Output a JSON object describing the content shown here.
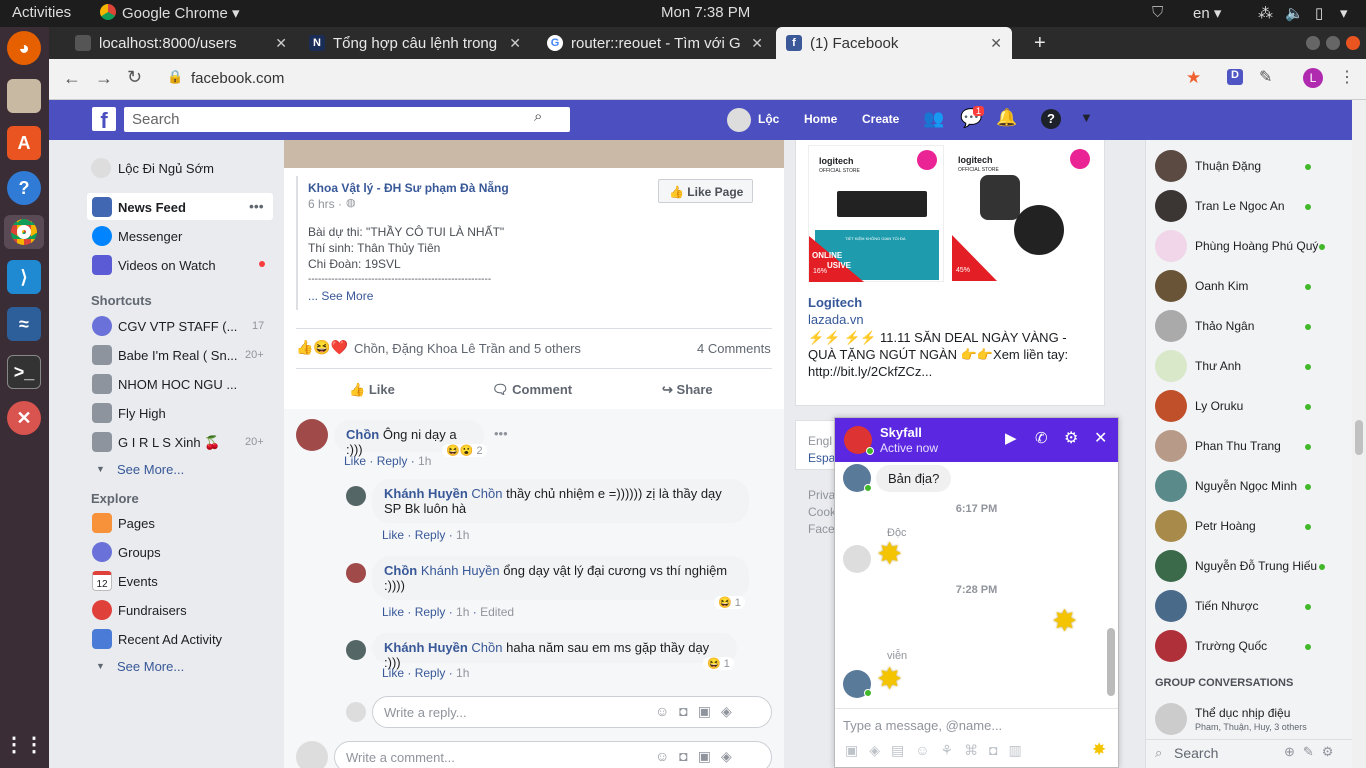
{
  "os": {
    "activities": "Activities",
    "app_menu": "Google Chrome",
    "clock": "Mon  7:38 PM",
    "lang": "en"
  },
  "browser": {
    "tabs": [
      {
        "title": "localhost:8000/users",
        "favicon": "page-icon"
      },
      {
        "title": "Tổng hợp câu lệnh trong",
        "favicon": "N"
      },
      {
        "title": "router::reouet - Tìm với G",
        "favicon": "G"
      },
      {
        "title": "(1) Facebook",
        "favicon": "f"
      }
    ],
    "url": "facebook.com",
    "ext_d": "D",
    "profile": "L"
  },
  "fb": {
    "search_placeholder": "Search",
    "user": "Lộc",
    "nav": {
      "home": "Home",
      "create": "Create"
    },
    "messages_badge": "1"
  },
  "left": {
    "profile": "Lộc Đi Ngủ Sớm",
    "items": [
      {
        "label": "News Feed"
      },
      {
        "label": "Messenger"
      },
      {
        "label": "Videos on Watch"
      }
    ],
    "shortcuts_title": "Shortcuts",
    "shortcuts": [
      {
        "label": "CGV VTP STAFF (...",
        "count": "17"
      },
      {
        "label": "Babe I'm Real ( Sn...",
        "count": "20+"
      },
      {
        "label": "NHOM HOC NGU ...",
        "count": ""
      },
      {
        "label": "Fly High",
        "count": ""
      },
      {
        "label": "G I R L S Xinh 🍒",
        "count": "20+"
      }
    ],
    "see_more": "See More...",
    "explore_title": "Explore",
    "explore": [
      {
        "label": "Pages"
      },
      {
        "label": "Groups"
      },
      {
        "label": "Events"
      },
      {
        "label": "Fundraisers"
      },
      {
        "label": "Recent Ad Activity"
      }
    ],
    "events_day": "12"
  },
  "post": {
    "page_name": "Khoa Vật lý - ĐH Sư phạm Đà Nẵng",
    "time": "6 hrs ·",
    "like_page": "Like Page",
    "lines": [
      "Bài dự thi: \"THẦY CÔ TUI LÀ NHẤT\"",
      "Thí sinh: Thân Thủy Tiên",
      "Chi Đoàn: 19SVL",
      "-------------------------------------------------------"
    ],
    "see_more": "... See More",
    "reactions_text": "Chồn, Đặng Khoa Lê Trần and 5 others",
    "comments_count": "4 Comments",
    "actions": {
      "like": "Like",
      "comment": "Comment",
      "share": "Share"
    }
  },
  "comments": [
    {
      "name": "Chồn",
      "text": "Ông ni dạy a :)))",
      "like": "Like",
      "reply": "Reply",
      "time": "1h",
      "react": "2"
    },
    {
      "name": "Khánh Huyền",
      "tag": "Chồn",
      "text": " thầy chủ nhiệm e =)))))) zị là thầy dạy SP Bk luôn hà",
      "text2": "SP Bk luôn hà",
      "like": "Like",
      "reply": "Reply",
      "time": "1h"
    },
    {
      "name": "Chồn",
      "tag": "Khánh Huyền",
      "text": " ổng dạy vật lý đại cương vs thí nghiệm",
      "text2": ":))))",
      "like": "Like",
      "reply": "Reply",
      "time": "1h",
      "edited": "Edited",
      "react": "1"
    },
    {
      "name": "Khánh Huyền",
      "tag": "Chồn",
      "text": " haha năm sau em ms gặp thầy dạy :)))",
      "like": "Like",
      "reply": "Reply",
      "time": "1h",
      "react": "1"
    }
  ],
  "reply_placeholder": "Write a reply...",
  "comment_placeholder": "Write a comment...",
  "ad": {
    "brand": "Logitech",
    "domain": "lazada.vn",
    "text": "⚡⚡ ⚡⚡ 11.11 SĂN DEAL NGÀY VÀNG - QUÀ TẶNG NGÚT NGÀN 👉👉Xem liền tay: http://bit.ly/2CkfZCz...",
    "card1_title": "logitech",
    "card1_sub": "OFFICIAL STORE",
    "card1_tag": "TIẾT KIỆM KHÔNG GIAN TỐI ĐA",
    "card1_badge": "16%",
    "card1_online": "ONLINE",
    "card1_usive": "USIVE",
    "card2_badge": "45%",
    "off": "OFF"
  },
  "footer_links": [
    "Engl",
    "Espa",
    "Priva",
    "Cook",
    "Face"
  ],
  "chat_list": [
    {
      "name": "Thuận Đặng"
    },
    {
      "name": "Tran Le Ngoc An"
    },
    {
      "name": "Phùng Hoàng Phú Quý"
    },
    {
      "name": "Oanh Kim"
    },
    {
      "name": "Thảo Ngân"
    },
    {
      "name": "Thư Anh"
    },
    {
      "name": "Ly Oruku"
    },
    {
      "name": "Phan Thu Trang"
    },
    {
      "name": "Nguyễn Ngọc Minh"
    },
    {
      "name": "Petr Hoàng"
    },
    {
      "name": "Nguyễn Đỗ Trung Hiếu"
    },
    {
      "name": "Tiến Nhược"
    },
    {
      "name": "Trường Quốc"
    }
  ],
  "group_title": "GROUP CONVERSATIONS",
  "group": {
    "name": "Thể dục nhịp điệu",
    "members": "Pham, Thuận, Huy, 3 others"
  },
  "chat_search": "Search",
  "messenger": {
    "name": "Skyfall",
    "status": "Active now",
    "msg1": "Bản địa?",
    "time1": "6:17 PM",
    "seen1": "Độc",
    "time2": "7:28 PM",
    "seen2": "viễn",
    "placeholder": "Type a message, @name..."
  }
}
